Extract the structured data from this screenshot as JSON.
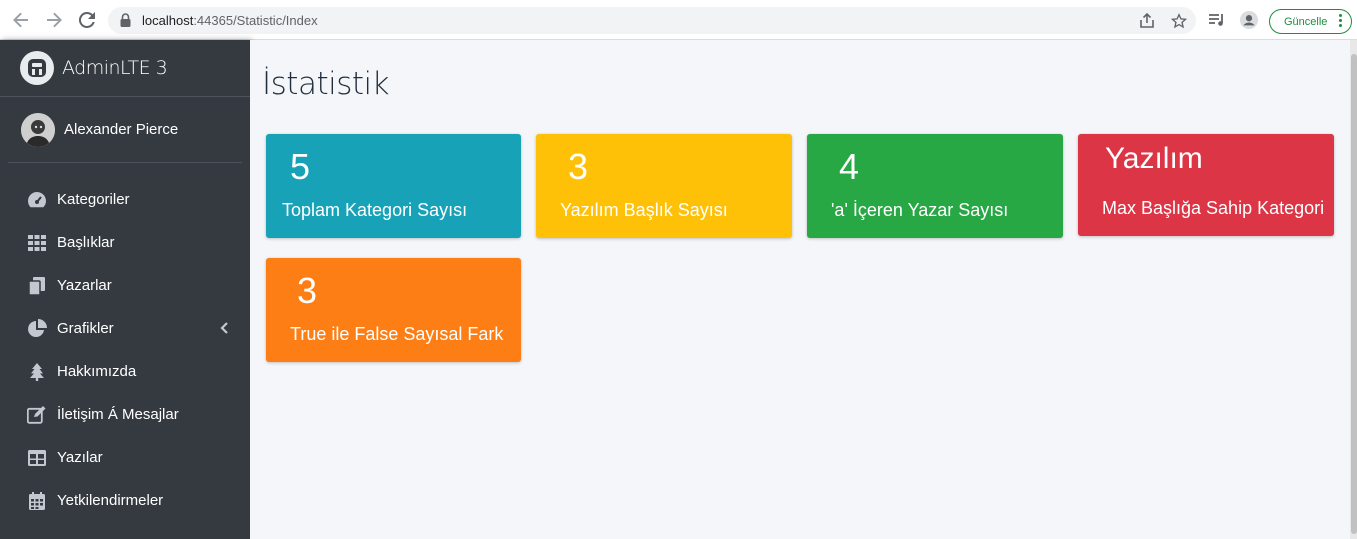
{
  "browser": {
    "url_host": "localhost",
    "url_rest": ":44365/Statistic/Index",
    "update_label": "Güncelle"
  },
  "sidebar": {
    "brand": "AdminLTE 3",
    "user": "Alexander Pierce",
    "items": [
      {
        "label": "Kategoriler",
        "icon": "tachometer-icon"
      },
      {
        "label": "Başlıklar",
        "icon": "grid-icon"
      },
      {
        "label": "Yazarlar",
        "icon": "copy-icon"
      },
      {
        "label": "Grafikler",
        "icon": "pie-chart-icon"
      },
      {
        "label": "Hakkımızda",
        "icon": "tree-icon"
      },
      {
        "label": "İletişim Á Mesajlar",
        "icon": "edit-icon"
      },
      {
        "label": "Yazılar",
        "icon": "table-icon"
      },
      {
        "label": "Yetkilendirmeler",
        "icon": "calendar-icon"
      }
    ]
  },
  "main": {
    "title": "İstatistik",
    "boxes": [
      {
        "value": "5",
        "label": "Toplam Kategori Sayısı",
        "color": "#17a2b8"
      },
      {
        "value": "3",
        "label": "Yazılım Başlık Sayısı",
        "color": "#ffc107"
      },
      {
        "value": "4",
        "label": "'a' İçeren Yazar Sayısı",
        "color": "#28a745"
      },
      {
        "value": "Yazılım",
        "label": "Max Başlığa Sahip Kategori",
        "color": "#dc3545"
      },
      {
        "value": "3",
        "label": "True ile False Sayısal Fark",
        "color": "#fd7e14"
      }
    ]
  }
}
